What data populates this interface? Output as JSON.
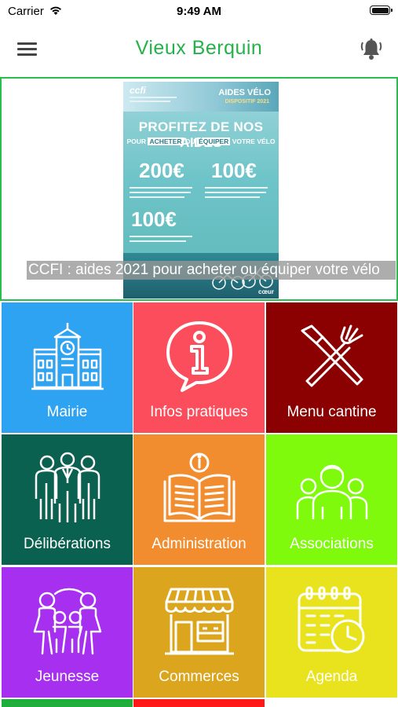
{
  "status_bar": {
    "carrier": "Carrier",
    "time": "9:49 AM"
  },
  "nav": {
    "title": "Vieux Berquin",
    "menu_icon": "hamburger-menu-icon",
    "bell_icon": "notification-bell-icon"
  },
  "banner": {
    "caption": "CCFI : aides 2021 pour acheter ou équiper votre vélo",
    "poster": {
      "logo": "ccfi",
      "header": "AIDES VÉLO",
      "subheader": "DISPOSITIF 2021",
      "headline": "PROFITEZ DE NOS AIDES",
      "line_parts": [
        "POUR",
        "ACHETER",
        "OU",
        "ÉQUIPER",
        "VOTRE VÉLO"
      ],
      "amounts": [
        "200€",
        "100€",
        "100€"
      ],
      "footer_logo": "cœur"
    }
  },
  "tiles": [
    {
      "label": "Mairie",
      "icon": "town-hall-icon",
      "color": "#2ea3f2"
    },
    {
      "label": "Infos pratiques",
      "icon": "info-icon",
      "color": "#fb4d5b"
    },
    {
      "label": "Menu cantine",
      "icon": "fork-knife-icon",
      "color": "#8b0000"
    },
    {
      "label": "Délibérations",
      "icon": "council-people-icon",
      "color": "#0b6150"
    },
    {
      "label": "Administration",
      "icon": "open-book-info-icon",
      "color": "#f18d2e"
    },
    {
      "label": "Associations",
      "icon": "group-people-icon",
      "color": "#7ffa0c"
    },
    {
      "label": "Jeunesse",
      "icon": "youth-family-icon",
      "color": "#a62ff0"
    },
    {
      "label": "Commerces",
      "icon": "shop-storefront-icon",
      "color": "#dba51e"
    },
    {
      "label": "Agenda",
      "icon": "calendar-clock-icon",
      "color": "#e9e31d"
    }
  ]
}
